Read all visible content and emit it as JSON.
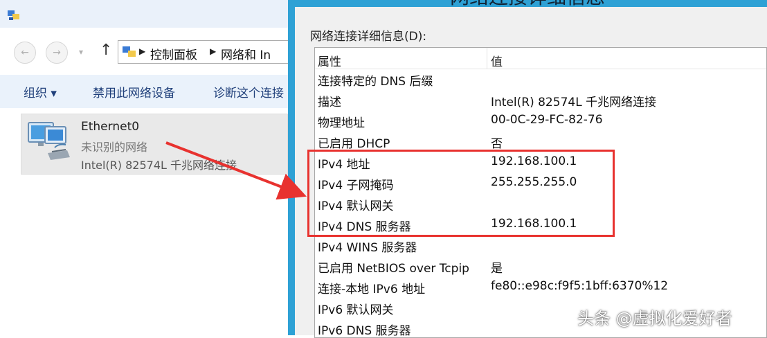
{
  "explorer": {
    "address_crumbs": [
      "控制面板",
      "网络和 In"
    ],
    "commands": [
      "组织 ▾",
      "禁用此网络设备",
      "诊断这个连接"
    ],
    "connection": {
      "name": "Ethernet0",
      "status": "未识别的网络",
      "adapter": "Intel(R) 82574L 千兆网络连接"
    }
  },
  "dialog": {
    "title_fragment": "网络连接详细信息",
    "details_label": "网络连接详细信息(D):",
    "columns": {
      "property": "属性",
      "value": "值"
    },
    "rows": [
      {
        "property": "连接特定的 DNS 后缀",
        "value": ""
      },
      {
        "property": "描述",
        "value": "Intel(R) 82574L 千兆网络连接"
      },
      {
        "property": "物理地址",
        "value": "00-0C-29-FC-82-76"
      },
      {
        "property": "已启用 DHCP",
        "value": "否"
      },
      {
        "property": "IPv4 地址",
        "value": "192.168.100.1"
      },
      {
        "property": "IPv4 子网掩码",
        "value": "255.255.255.0"
      },
      {
        "property": "IPv4 默认网关",
        "value": ""
      },
      {
        "property": "IPv4 DNS 服务器",
        "value": "192.168.100.1"
      },
      {
        "property": "IPv4 WINS 服务器",
        "value": ""
      },
      {
        "property": "已启用 NetBIOS over Tcpip",
        "value": "是"
      },
      {
        "property": "连接-本地 IPv6 地址",
        "value": "fe80::e98c:f9f5:1bff:6370%12"
      },
      {
        "property": "IPv6 默认网关",
        "value": ""
      },
      {
        "property": "IPv6 DNS 服务器",
        "value": ""
      }
    ]
  },
  "watermark": "头条 @虚拟化爱好者",
  "colors": {
    "dialog_frame": "#2ea1d5",
    "highlight": "#e8322f",
    "command_text": "#1f3f7a"
  }
}
